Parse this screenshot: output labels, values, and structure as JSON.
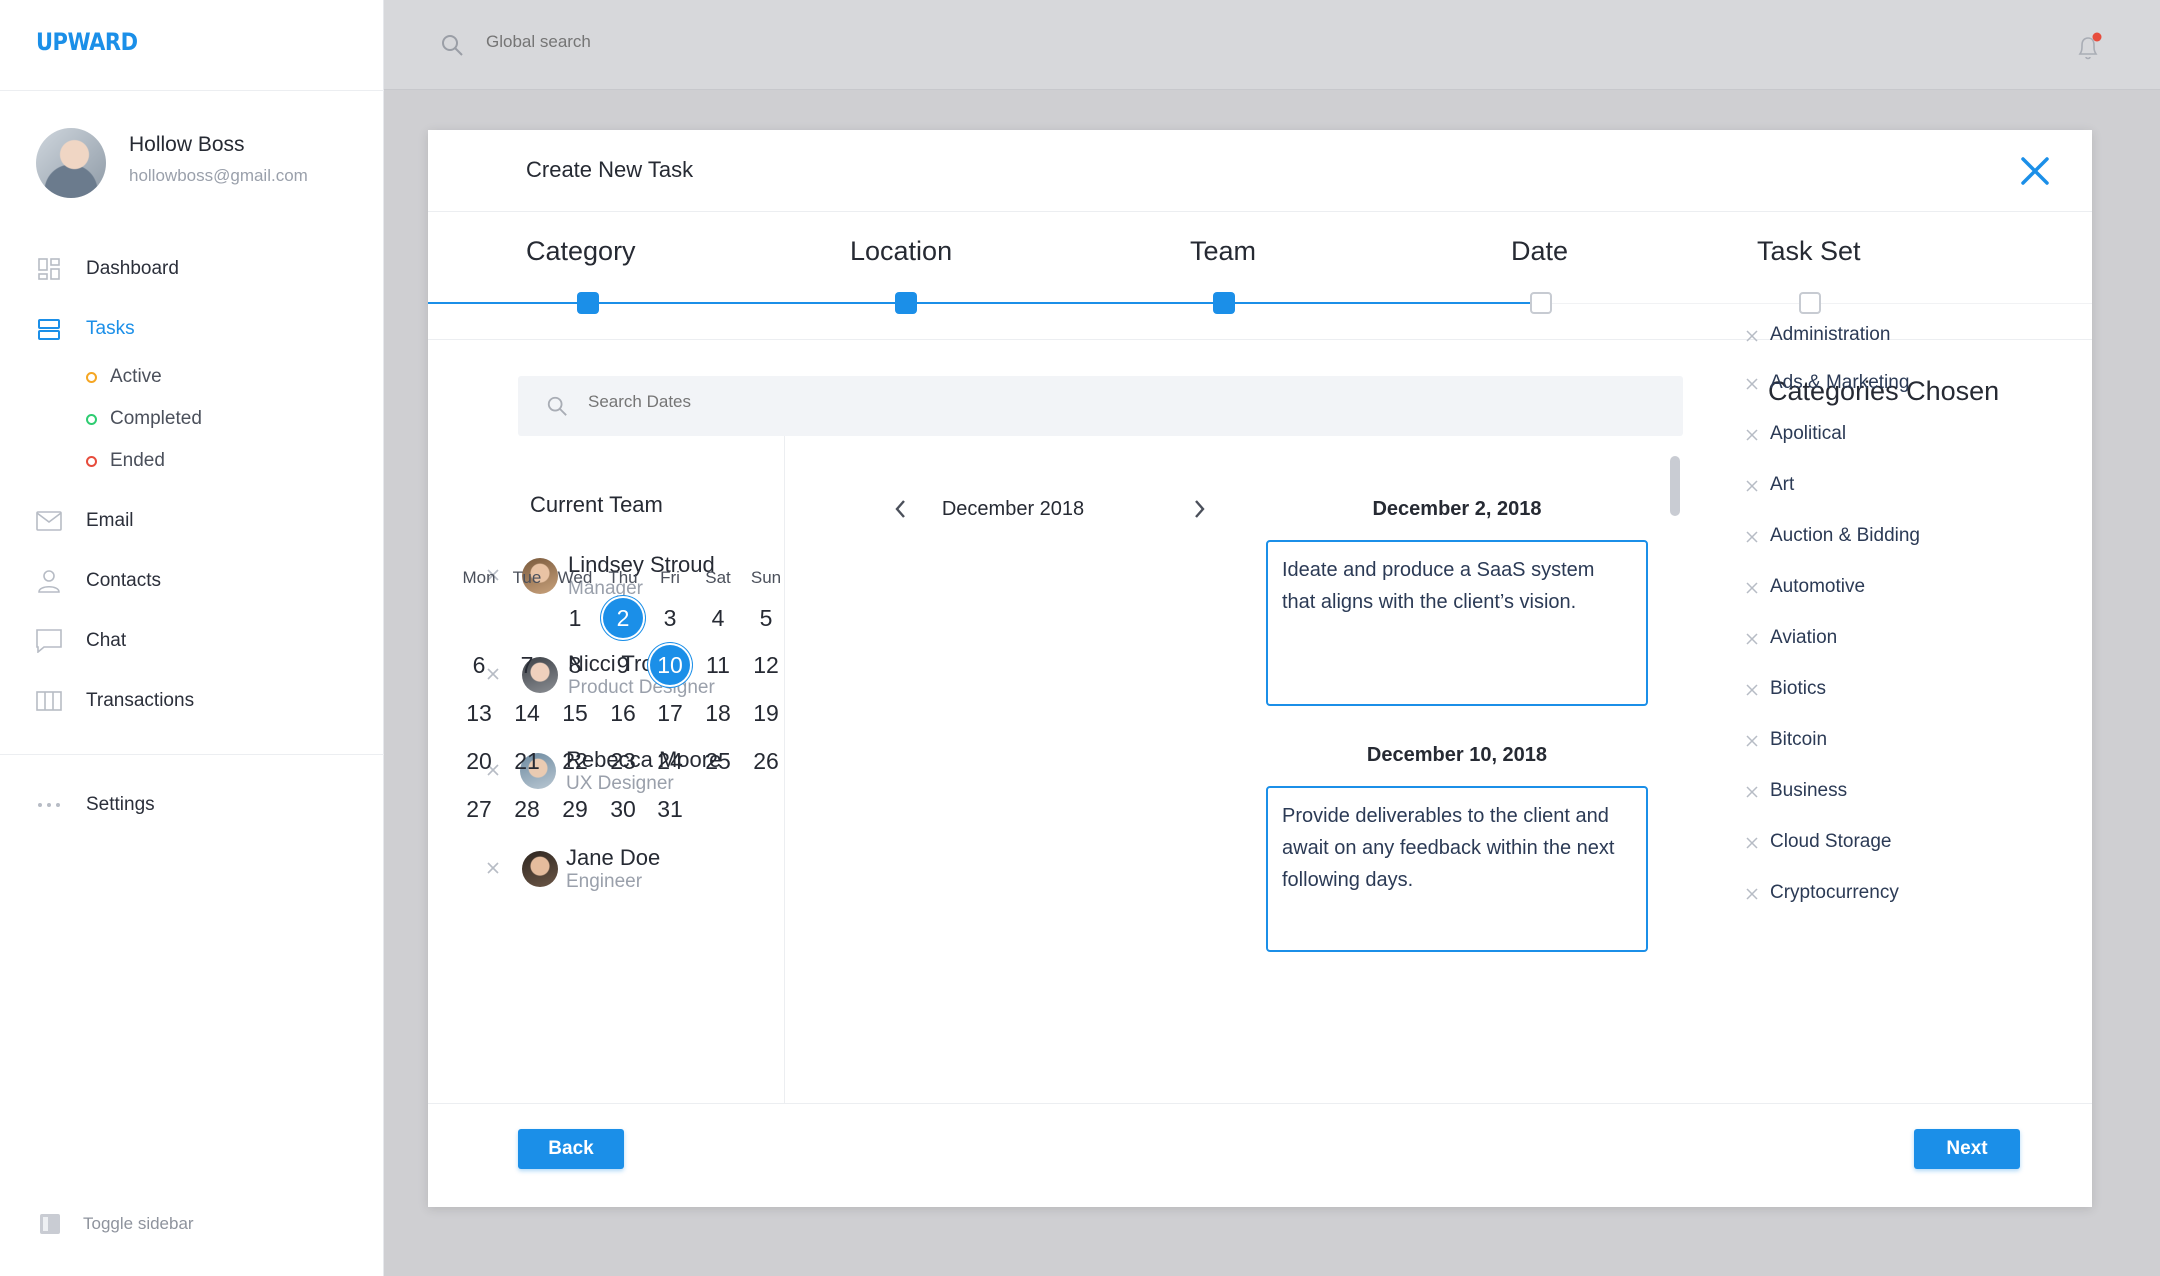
{
  "app": {
    "logo": "UPWARD"
  },
  "user": {
    "name": "Hollow Boss",
    "email": "hollowboss@gmail.com"
  },
  "nav": [
    {
      "label": "Dashboard",
      "icon": "dashboard-icon"
    },
    {
      "label": "Tasks",
      "icon": "tasks-icon",
      "active": true
    },
    {
      "label": "Email",
      "icon": "email-icon"
    },
    {
      "label": "Contacts",
      "icon": "contacts-icon"
    },
    {
      "label": "Chat",
      "icon": "chat-icon"
    },
    {
      "label": "Transactions",
      "icon": "transactions-icon"
    }
  ],
  "task_subnav": [
    {
      "label": "Active",
      "color": "#f5a623"
    },
    {
      "label": "Completed",
      "color": "#2ecc71"
    },
    {
      "label": "Ended",
      "color": "#e74c3c"
    }
  ],
  "settings_label": "Settings",
  "toggle_sidebar_label": "Toggle sidebar",
  "topbar": {
    "search_placeholder": "Global search",
    "notification_dot_color": "#e74c3c"
  },
  "modal": {
    "title": "Create New Task",
    "steps": [
      {
        "label": "Category",
        "done": true
      },
      {
        "label": "Location",
        "done": true
      },
      {
        "label": "Team",
        "done": true
      },
      {
        "label": "Date",
        "done": false
      },
      {
        "label": "Task Set",
        "done": false
      }
    ],
    "search_placeholder": "Search Dates",
    "team_title": "Current Team",
    "team": [
      {
        "name": "Lindsey Stroud",
        "role": "Manager"
      },
      {
        "name": "Nicci Troiani",
        "role": "Product Designer"
      },
      {
        "name": "Rebecca Moore",
        "role": "UX Designer"
      },
      {
        "name": "Jane Doe",
        "role": "Engineer"
      }
    ],
    "calendar": {
      "month": "December 2018",
      "weekdays": [
        "Mon",
        "Tue",
        "Wed",
        "Thu",
        "Fri",
        "Sat",
        "Sun"
      ],
      "weeks": [
        [
          "",
          "",
          "1",
          "2",
          "3",
          "4",
          "5"
        ],
        [
          "6",
          "7",
          "8",
          "9",
          "10",
          "11",
          "12"
        ],
        [
          "13",
          "14",
          "15",
          "16",
          "17",
          "18",
          "19"
        ],
        [
          "20",
          "21",
          "22",
          "23",
          "24",
          "25",
          "26"
        ],
        [
          "27",
          "28",
          "29",
          "30",
          "31",
          "",
          ""
        ]
      ],
      "selected": [
        "2",
        "10"
      ]
    },
    "date_notes": [
      {
        "date": "December 2, 2018",
        "text": "Ideate and produce a SaaS system that aligns with the client’s vision."
      },
      {
        "date": "December 10, 2018",
        "text": "Provide deliverables to the client and await on any feedback within the next following days."
      }
    ],
    "categories_title": "Categories Chosen",
    "categories": [
      "Administration",
      "Ads & Marketing",
      "Apolitical",
      "Art",
      "Auction & Bidding",
      "Automotive",
      "Aviation",
      "Biotics",
      "Bitcoin",
      "Business",
      "Cloud Storage",
      "Cryptocurrency"
    ],
    "back_label": "Back",
    "next_label": "Next"
  },
  "colors": {
    "accent": "#1b8fe8"
  }
}
